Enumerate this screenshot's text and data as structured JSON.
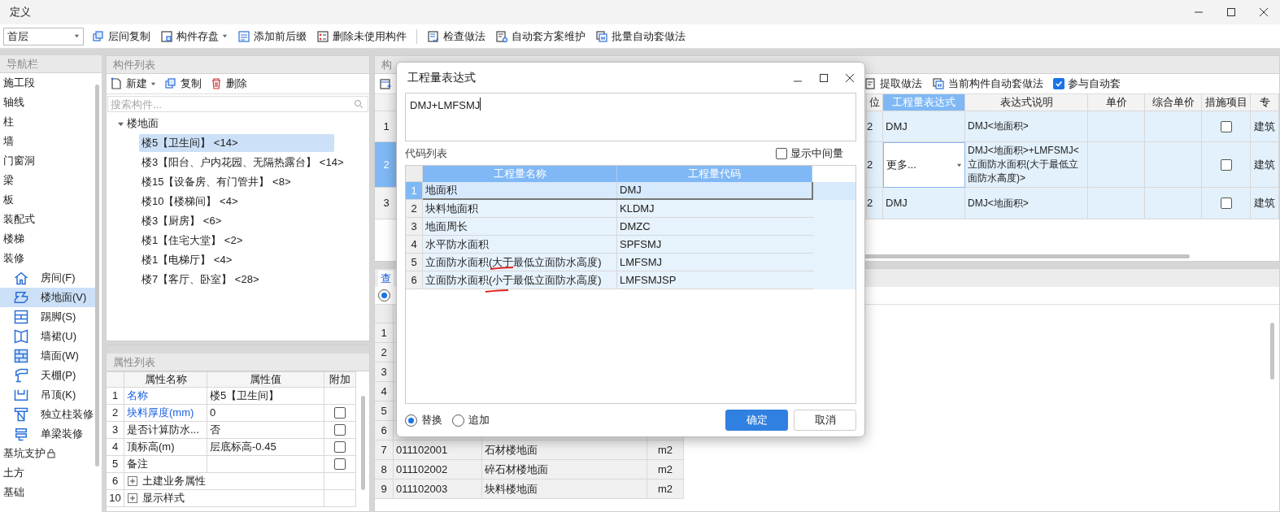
{
  "window": {
    "title": "定义"
  },
  "toolbar": {
    "floor": "首层",
    "groups": [
      {
        "items": [
          {
            "label": "层间复制",
            "dropdown": false
          },
          {
            "label": "构件存盘",
            "dropdown": true
          },
          {
            "label": "添加前后缀",
            "dropdown": false
          },
          {
            "label": "删除未使用构件",
            "dropdown": false
          }
        ]
      },
      {
        "items": [
          {
            "label": "检查做法",
            "dropdown": false
          },
          {
            "label": "自动套方案维护",
            "dropdown": false
          },
          {
            "label": "批量自动套做法",
            "dropdown": false
          }
        ]
      }
    ]
  },
  "nav": {
    "title": "导航栏",
    "items": [
      {
        "label": "施工段",
        "locked": false
      },
      {
        "label": "轴线",
        "locked": false
      },
      {
        "label": "柱",
        "locked": false
      },
      {
        "label": "墙",
        "locked": false
      },
      {
        "label": "门窗洞",
        "locked": false
      },
      {
        "label": "梁",
        "locked": false
      },
      {
        "label": "板",
        "locked": false
      },
      {
        "label": "装配式",
        "locked": false
      },
      {
        "label": "楼梯",
        "locked": false
      },
      {
        "label": "装修",
        "locked": false,
        "children": [
          {
            "label": "房间(F)",
            "selected": false
          },
          {
            "label": "楼地面(V)",
            "selected": true
          },
          {
            "label": "踢脚(S)",
            "selected": false
          },
          {
            "label": "墙裙(U)",
            "selected": false
          },
          {
            "label": "墙面(W)",
            "selected": false
          },
          {
            "label": "天棚(P)",
            "selected": false
          },
          {
            "label": "吊顶(K)",
            "selected": false
          },
          {
            "label": "独立柱装修",
            "selected": false
          },
          {
            "label": "单梁装修",
            "selected": false
          }
        ]
      },
      {
        "label": "基坑支护",
        "locked": true
      },
      {
        "label": "土方",
        "locked": false
      },
      {
        "label": "基础",
        "locked": false
      }
    ]
  },
  "component_list": {
    "title": "构件列表",
    "actions": [
      {
        "label": "新建",
        "dropdown": true
      },
      {
        "label": "复制",
        "dropdown": false
      },
      {
        "label": "删除",
        "dropdown": false
      }
    ],
    "search": {
      "placeholder": "搜索构件..."
    },
    "tree": [
      {
        "label": "楼地面",
        "expanded": true,
        "children": [
          {
            "label": "楼5【卫生间】 <14>",
            "selected": true
          },
          {
            "label": "楼3【阳台、户内花园、无隔热露台】 <14>",
            "selected": false
          },
          {
            "label": "楼15【设备房、有门管井】 <8>",
            "selected": false
          },
          {
            "label": "楼10【楼梯间】 <4>",
            "selected": false
          },
          {
            "label": "楼3【厨房】 <6>",
            "selected": false
          },
          {
            "label": "楼1【住宅大堂】 <2>",
            "selected": false
          },
          {
            "label": "楼1【电梯厅】 <4>",
            "selected": false
          },
          {
            "label": "楼7【客厅、卧室】 <28>",
            "selected": false
          }
        ]
      }
    ]
  },
  "properties": {
    "title": "属性列表",
    "columns": [
      "属性名称",
      "属性值",
      "附加"
    ],
    "rows": [
      {
        "index": "1",
        "kind": "field",
        "name": "名称",
        "value": "楼5【卫生间】",
        "emphasized": true
      },
      {
        "index": "2",
        "kind": "field",
        "name": "块料厚度(mm)",
        "value": "0",
        "emphasized": true,
        "checked": false
      },
      {
        "index": "3",
        "kind": "field",
        "name": "是否计算防水...",
        "value": "否",
        "emphasized": false,
        "checked": false
      },
      {
        "index": "4",
        "kind": "field",
        "name": "顶标高(m)",
        "value": "层底标高-0.45",
        "emphasized": false,
        "checked": false
      },
      {
        "index": "5",
        "kind": "field",
        "name": "备注",
        "emphasized": false,
        "checked": false
      },
      {
        "index": "6",
        "kind": "group",
        "name": "土建业务属性",
        "expanded": false
      },
      {
        "index": "10",
        "kind": "group",
        "name": "显示样式",
        "expanded": false
      }
    ]
  },
  "methods": {
    "title": "构",
    "toolbar": [
      {
        "label": "提取做法"
      },
      {
        "label": "当前构件自动套做法"
      }
    ],
    "auto_apply": {
      "label": "参与自动套",
      "checked": true
    },
    "columns": [
      {
        "label": "位",
        "selected": false
      },
      {
        "label": "工程量表达式",
        "selected": true
      },
      {
        "label": "表达式说明",
        "selected": false
      },
      {
        "label": "单价",
        "selected": false
      },
      {
        "label": "综合单价",
        "selected": false
      },
      {
        "label": "措施项目",
        "selected": false
      },
      {
        "label": "专",
        "selected": false
      }
    ],
    "rows": [
      {
        "index": "1",
        "selected": false,
        "unit": "2",
        "expression": {
          "kind": "text",
          "value": "DMJ"
        },
        "description": "DMJ<地面积>",
        "measure": false,
        "category": "建筑"
      },
      {
        "index": "2",
        "selected": true,
        "unit": "2",
        "expression": {
          "kind": "dropdown",
          "value": "更多..."
        },
        "description": "DMJ<地面积>+LMFSMJ<立面防水面积(大于最低立面防水高度)>",
        "measure": false,
        "category": "建筑"
      },
      {
        "index": "3",
        "selected": false,
        "unit": "2",
        "expression": {
          "kind": "text",
          "value": "DMJ"
        },
        "description": "DMJ<地面积>",
        "measure": false,
        "category": "建筑"
      }
    ]
  },
  "query": {
    "tab": {
      "label": "查",
      "selected": true
    },
    "option": {
      "selected": true
    },
    "rows": [
      {
        "index": "1"
      },
      {
        "index": "2"
      },
      {
        "index": "3"
      },
      {
        "index": "4"
      },
      {
        "index": "5"
      },
      {
        "index": "6"
      },
      {
        "index": "7",
        "code": "011102001",
        "name": "石材楼地面",
        "unit": "m2"
      },
      {
        "index": "8",
        "code": "011102002",
        "name": "碎石材楼地面",
        "unit": "m2"
      },
      {
        "index": "9",
        "code": "011102003",
        "name": "块料楼地面",
        "unit": "m2"
      }
    ]
  },
  "dialog": {
    "title": "工程量表达式",
    "expression": "DMJ+LMFSMJ",
    "code_list_label": "代码列表",
    "show_intermediate": {
      "label": "显示中间量",
      "checked": false
    },
    "columns": [
      "工程量名称",
      "工程量代码"
    ],
    "rows": [
      {
        "index": "1",
        "name": "地面积",
        "code": "DMJ",
        "selected": true,
        "marked": false
      },
      {
        "index": "2",
        "name": "块料地面积",
        "code": "KLDMJ",
        "selected": false,
        "marked": false
      },
      {
        "index": "3",
        "name": "地面周长",
        "code": "DMZC",
        "selected": false,
        "marked": false
      },
      {
        "index": "4",
        "name": "水平防水面积",
        "code": "SPFSMJ",
        "selected": false,
        "marked": false
      },
      {
        "index": "5",
        "name": "立面防水面积(大于最低立面防水高度)",
        "code": "LMFSMJ",
        "selected": false,
        "marked": true
      },
      {
        "index": "6",
        "name": "立面防水面积(小于最低立面防水高度)",
        "code": "LMFSMJSP",
        "selected": false,
        "marked": true
      }
    ],
    "mode": [
      {
        "label": "替换",
        "selected": true
      },
      {
        "label": "追加",
        "selected": false
      }
    ],
    "buttons": [
      {
        "label": "确定",
        "kind": "primary"
      },
      {
        "label": "取消",
        "kind": "secondary"
      }
    ]
  }
}
